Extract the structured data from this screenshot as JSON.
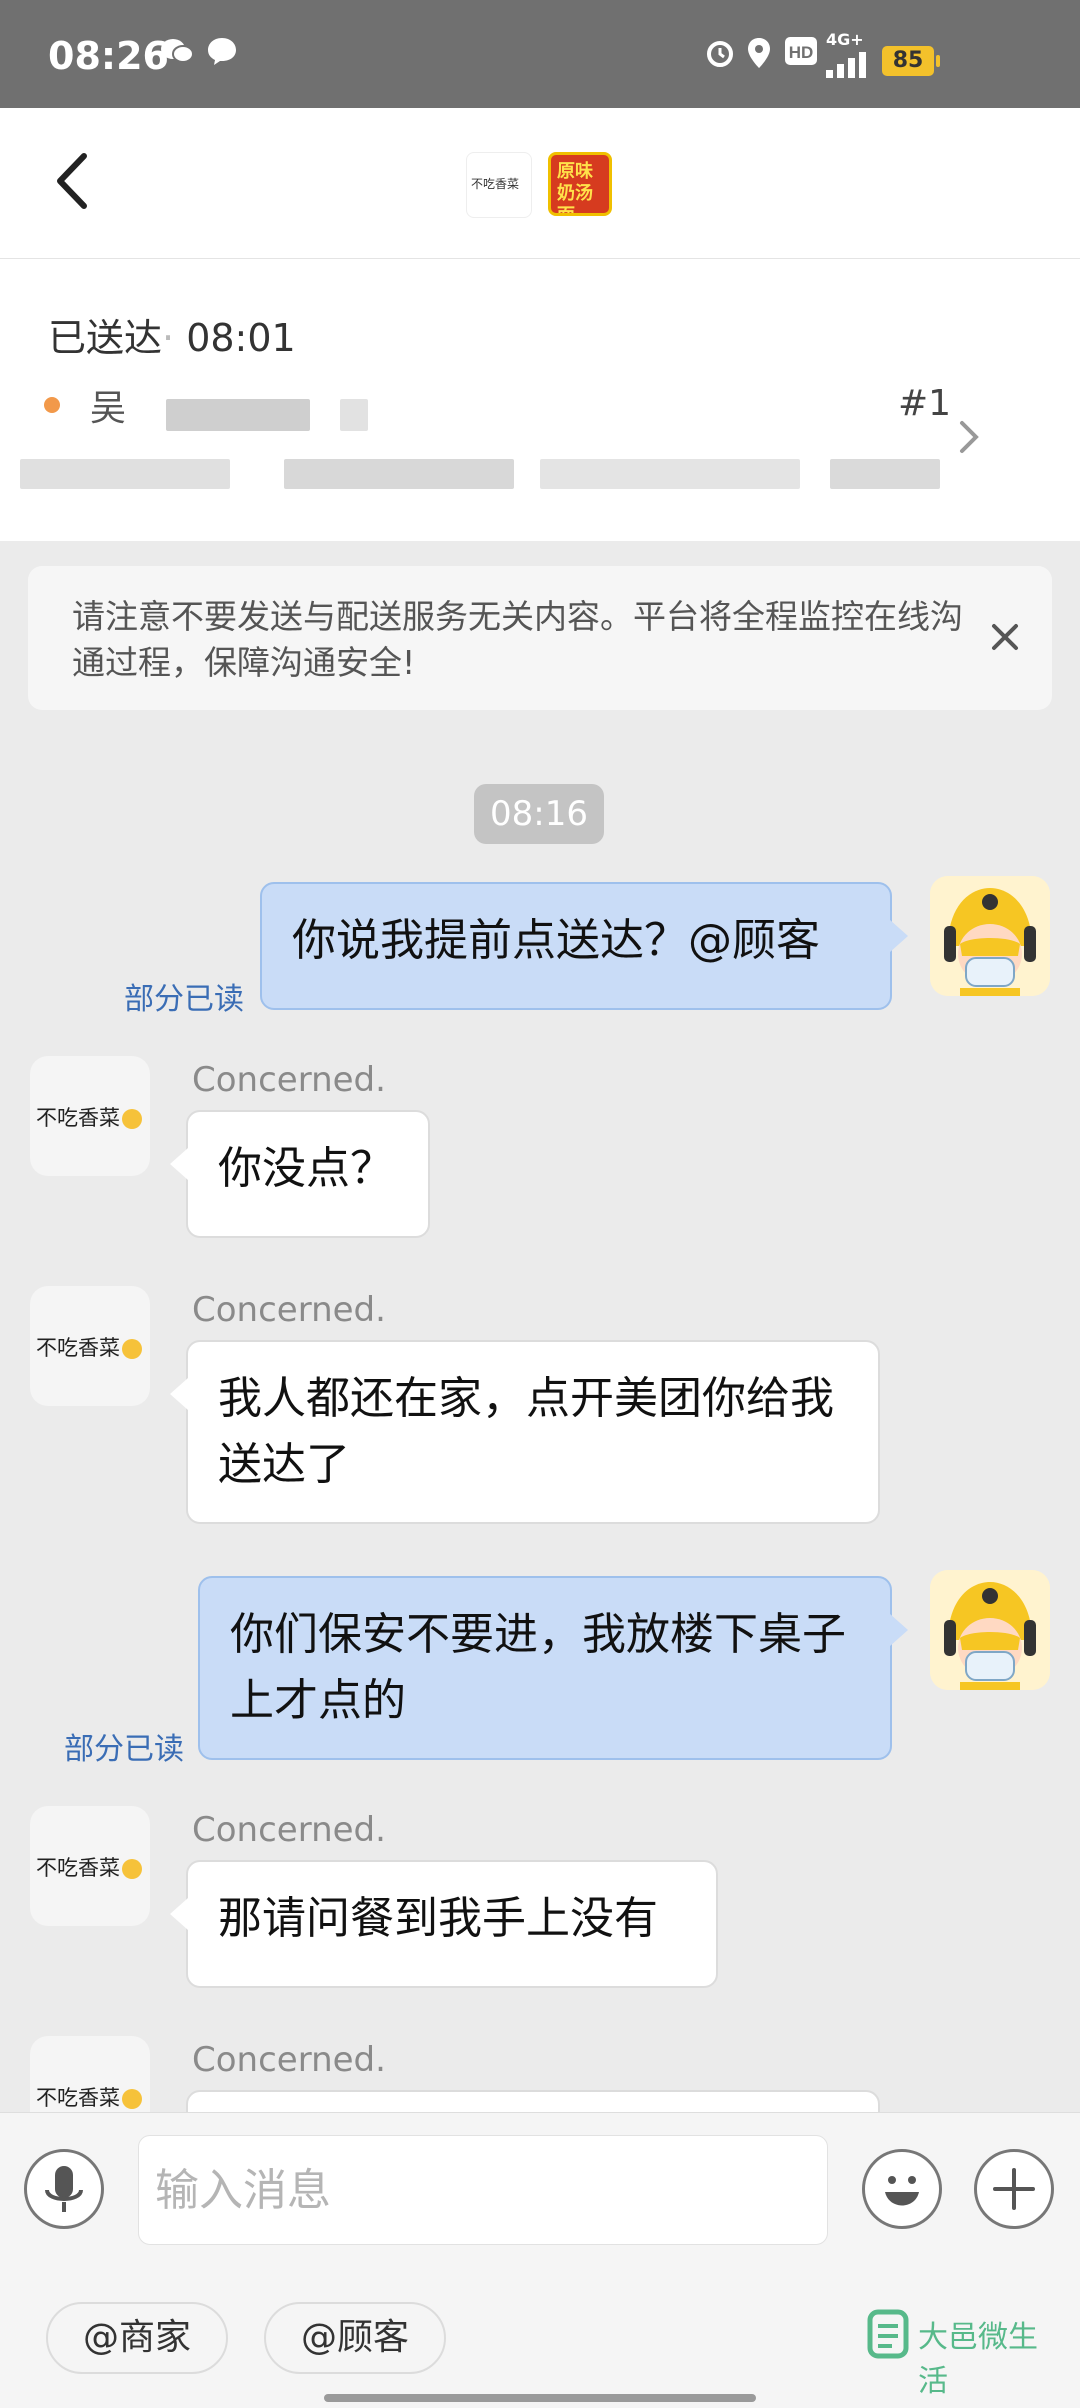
{
  "status_bar": {
    "time": "08:26",
    "network": "4G+",
    "battery": "85"
  },
  "order": {
    "status_label": "已送达",
    "status_time": "08:01",
    "customer_initial": "吴",
    "order_number": "#1"
  },
  "notice": {
    "text": "请注意不要发送与配送服务无关内容。平台将全程监控在线沟通过程，保障沟通安全!"
  },
  "chat": {
    "timestamp": "08:16",
    "messages": [
      {
        "direction": "out",
        "text": "你说我提前点送达？@顾客",
        "read_status": "部分已读"
      },
      {
        "direction": "in",
        "sender": "Concerned.",
        "avatar_label": "不吃香菜",
        "text": "你没点？"
      },
      {
        "direction": "in",
        "sender": "Concerned.",
        "avatar_label": "不吃香菜",
        "text": "我人都还在家，点开美团你给我送达了"
      },
      {
        "direction": "out",
        "text": "你们保安不要进，我放楼下桌子上才点的",
        "read_status": "部分已读"
      },
      {
        "direction": "in",
        "sender": "Concerned.",
        "avatar_label": "不吃香菜",
        "text": "那请问餐到我手上没有"
      },
      {
        "direction": "in",
        "sender": "Concerned.",
        "avatar_label": "不吃香菜",
        "text": ""
      }
    ]
  },
  "header": {
    "avatar1_label": "不吃香菜",
    "avatar2_label": "原味奶汤面"
  },
  "composer": {
    "placeholder": "输入消息"
  },
  "quick_mentions": [
    "@商家",
    "@顾客"
  ],
  "watermark": {
    "text": "大邑微生活"
  },
  "colors": {
    "outgoing_bubble": "#c9dcf7",
    "incoming_bubble": "#ffffff",
    "read_status": "#3a6db5",
    "status_bar": "#707070"
  }
}
